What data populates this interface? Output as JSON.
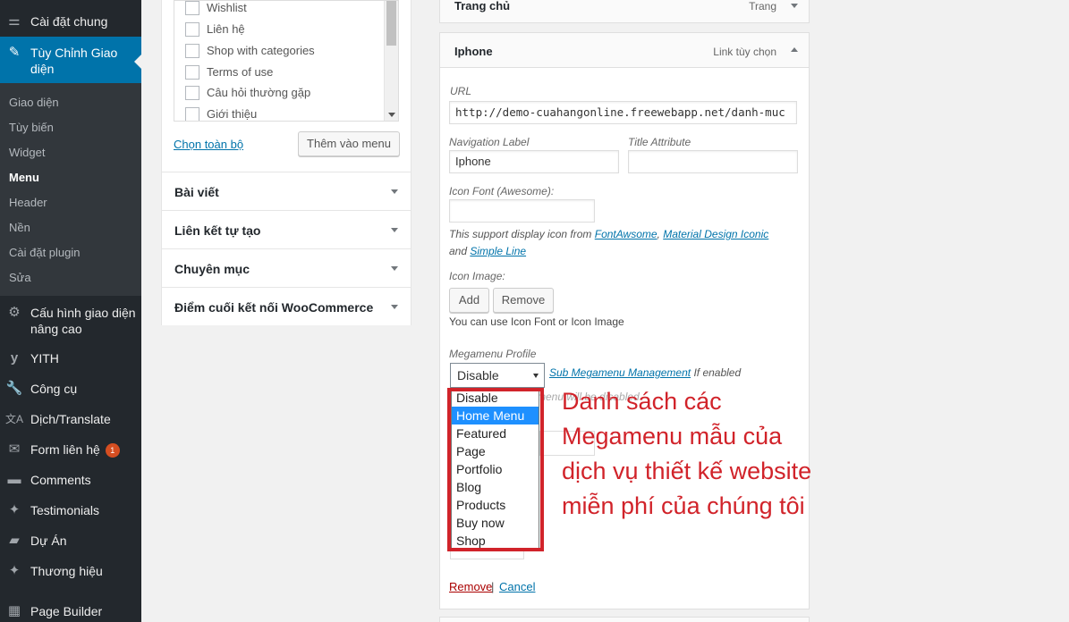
{
  "sidebar": {
    "top_item": {
      "label": "Cài đặt chung",
      "icon": "settings-sliders-icon"
    },
    "active_item": {
      "label_line1": "Tùy Chỉnh Giao",
      "label_line2": "diện",
      "icon": "paintbrush-icon"
    },
    "submenu": [
      "Giao diện",
      "Tùy biến",
      "Widget",
      "Menu",
      "Header",
      "Nền",
      "Cài đặt plugin",
      "Sửa"
    ],
    "current_submenu": "Menu",
    "items": [
      {
        "label_line1": "Cấu hình giao diện",
        "label_line2": "nâng cao",
        "icon": "gear-icon"
      },
      {
        "label": "YITH",
        "icon": "yith-logo-icon"
      },
      {
        "label": "Công cụ",
        "icon": "wrench-icon"
      },
      {
        "label": "Dịch/Translate",
        "icon": "translate-icon"
      },
      {
        "label": "Form liên hệ",
        "icon": "envelope-icon",
        "badge": "1"
      },
      {
        "label": "Comments",
        "icon": "comment-bubble-icon"
      },
      {
        "label": "Testimonials",
        "icon": "pin-icon"
      },
      {
        "label": "Dự Án",
        "icon": "folder-icon"
      },
      {
        "label": "Thương hiệu",
        "icon": "pin-icon"
      },
      {
        "label": "Page Builder",
        "icon": "builder-icon"
      }
    ]
  },
  "pages_box": {
    "items": [
      "Wishlist",
      "Liên hệ",
      "Shop with categories",
      "Terms of use",
      "Câu hỏi thường gặp",
      "Giới thiệu"
    ],
    "select_all": "Chọn toàn bộ",
    "add_button": "Thêm vào menu"
  },
  "accordion": [
    "Bài viết",
    "Liên kết tự tạo",
    "Chuyên mục",
    "Điểm cuối kết nối WooCommerce"
  ],
  "menu_items": {
    "top": {
      "title": "Trang chủ",
      "type": "Trang"
    },
    "open": {
      "title": "Iphone",
      "type": "Link tùy chọn"
    }
  },
  "settings": {
    "url_label": "URL",
    "url_value": "http://demo-cuahangonline.freewebapp.net/danh-muc",
    "nav_label": "Navigation Label",
    "nav_value": "Iphone",
    "title_attr_label": "Title Attribute",
    "title_attr_value": "",
    "icon_font_label": "Icon Font (Awesome):",
    "support_text_1": "This support display icon from ",
    "link_fontawesome": "FontAwsome",
    "comma": ", ",
    "link_material": "Material Design Iconic",
    "support_text_2": "and ",
    "link_simpleline": "Simple Line",
    "icon_image_label": "Icon Image:",
    "add_button": "Add",
    "remove_button": "Remove",
    "icon_hint": "You can use Icon Font or Icon Image",
    "megamenu_label": "Megamenu Profile",
    "megamenu_value": "Disable",
    "sub_megamenu_link": "Sub Megamenu Management",
    "if_enabled": " If enabled",
    "hidden_note": "menu will be disabled",
    "megamenu_options": [
      "Disable",
      "Home Menu",
      "Featured",
      "Page",
      "Portfolio",
      "Blog",
      "Products",
      "Buy now",
      "Shop"
    ],
    "highlighted_option": "Home Menu",
    "remove_link": "Remove",
    "separator": "|",
    "cancel_link": "Cancel"
  },
  "annotation": "Danh sách các Megamenu mẫu của dịch vụ thiết kế website miễn phí của chúng tôi",
  "colors": {
    "sidebar_bg": "#23282d",
    "active_bg": "#0073aa",
    "annotation_red": "#d1232a",
    "highlight_blue": "#1e90ff"
  }
}
